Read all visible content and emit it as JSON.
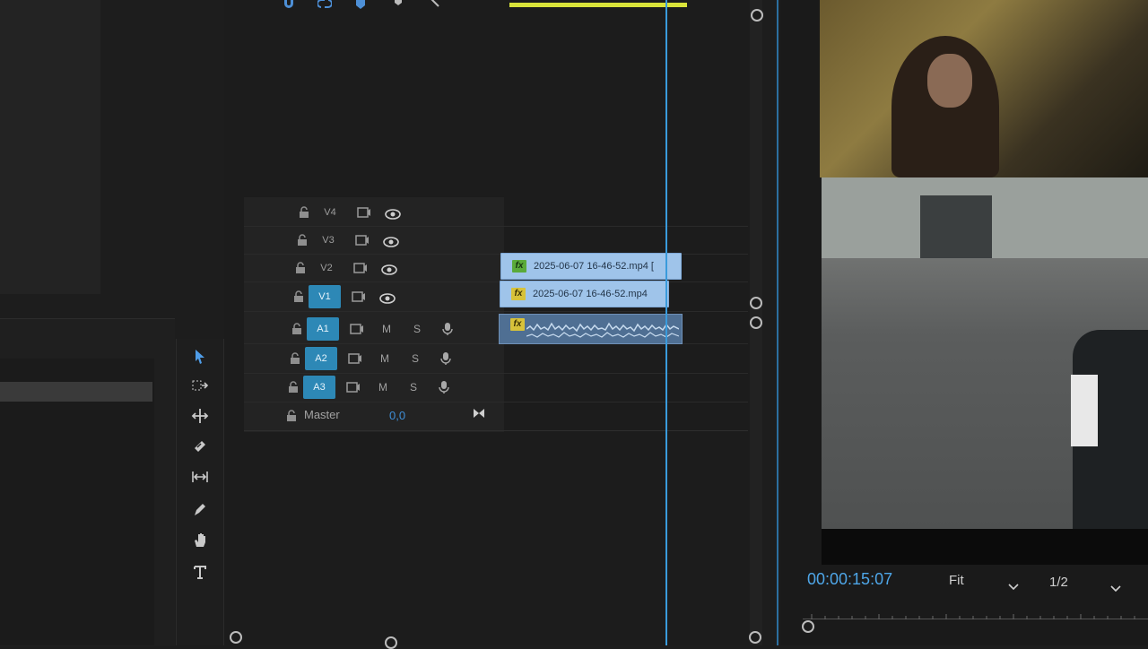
{
  "timeline": {
    "video_tracks": [
      {
        "label": "V4",
        "targeted": false
      },
      {
        "label": "V3",
        "targeted": false
      },
      {
        "label": "V2",
        "targeted": false
      },
      {
        "label": "V1",
        "targeted": true
      }
    ],
    "audio_tracks": [
      {
        "label": "A1",
        "mute": "M",
        "solo": "S"
      },
      {
        "label": "A2",
        "mute": "M",
        "solo": "S"
      },
      {
        "label": "A3",
        "mute": "M",
        "solo": "S"
      }
    ],
    "master": {
      "label": "Master",
      "value": "0,0"
    },
    "clips": {
      "v2": {
        "name": "2025-06-07 16-46-52.mp4 [",
        "fx": "fx"
      },
      "v1": {
        "name": "2025-06-07 16-46-52.mp4",
        "fx": "fx"
      },
      "a1": {
        "fx": "fx"
      }
    }
  },
  "monitor": {
    "timecode": "00:00:15:07",
    "zoom": "Fit",
    "resolution": "1/2"
  },
  "colors": {
    "accent": "#3a9bdc",
    "clip": "#9fc4ea",
    "target": "#2d88b6",
    "timecode": "#4ea6e8"
  },
  "icons": {
    "tools": [
      "selection-icon",
      "track-select-icon",
      "ripple-edit-icon",
      "razor-icon",
      "slip-icon",
      "pen-icon",
      "hand-icon",
      "type-icon"
    ]
  }
}
